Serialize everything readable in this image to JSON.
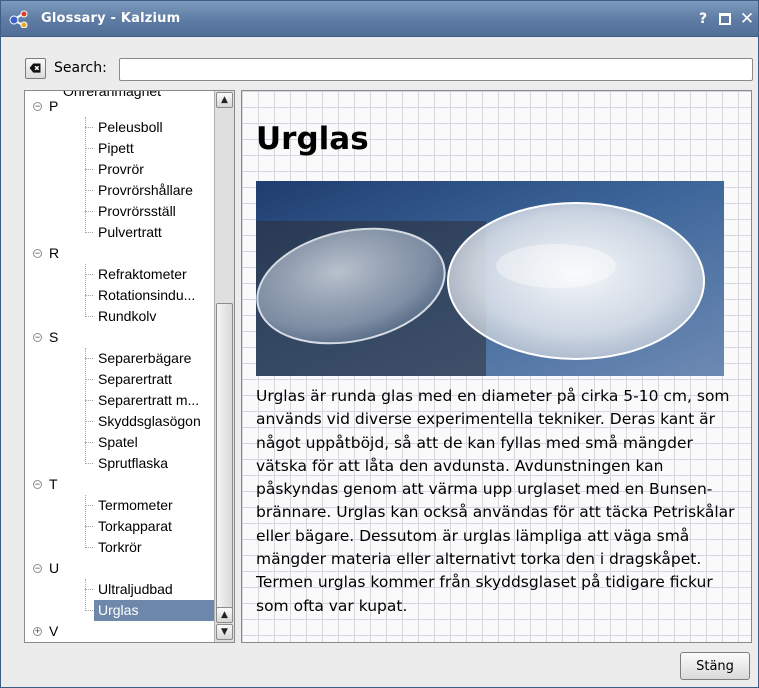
{
  "window": {
    "title": "Glossary - Kalzium",
    "help_glyph": "?",
    "close_glyph": "✕",
    "icons": {
      "app": "kalzium-molecule-icon",
      "help": "help-icon",
      "maximize": "maximize-icon",
      "close": "close-icon"
    }
  },
  "search": {
    "label": "Search:",
    "value": "",
    "placeholder": "",
    "clear_icon": "clear-text-icon"
  },
  "tree": {
    "partial_top_label": "Ohreranmagnet",
    "groups": [
      {
        "letter": "P",
        "expanded": true,
        "items": [
          "Peleusboll",
          "Pipett",
          "Provrör",
          "Provrörshållare",
          "Provrörsställ",
          "Pulvertratt"
        ]
      },
      {
        "letter": "R",
        "expanded": true,
        "items": [
          "Refraktometer",
          "Rotationsindu...",
          "Rundkolv"
        ]
      },
      {
        "letter": "S",
        "expanded": true,
        "items": [
          "Separerbägare",
          "Separertratt",
          "Separertratt m...",
          "Skyddsglasögon",
          "Spatel",
          "Sprutflaska"
        ]
      },
      {
        "letter": "T",
        "expanded": true,
        "items": [
          "Termometer",
          "Torkapparat",
          "Torkrör"
        ]
      },
      {
        "letter": "U",
        "expanded": true,
        "items": [
          "Ultraljudbad",
          "Urglas"
        ]
      },
      {
        "letter": "V",
        "expanded": false,
        "items": []
      }
    ],
    "selected_item": "Urglas",
    "expanded_glyph": "−",
    "collapsed_glyph": "+",
    "scroll_up_glyph": "▲",
    "scroll_down_glyph": "▼"
  },
  "content": {
    "title": "Urglas",
    "image": "watch-glass-photo",
    "body": "Urglas är runda glas med en diameter på cirka 5-10 cm, som används vid diverse experimentella tekniker. Deras kant är något uppåtböjd, så att de kan fyllas med små mängder vätska för att låta den avdunsta. Avdunstningen kan påskyndas genom att värma upp urglaset med en Bunsen-brännare. Urglas kan också användas för att täcka Petriskålar eller bägare. Dessutom är urglas lämpliga att väga små mängder materia eller alternativt torka den i dragskåpet. Termen urglas kommer från skyddsglaset på tidigare fickur som ofta var kupat."
  },
  "footer": {
    "close_label": "Stäng"
  },
  "colors": {
    "titlebar": "#6b88ae",
    "selection": "#6e88ab",
    "grid": "#d6d6df"
  }
}
